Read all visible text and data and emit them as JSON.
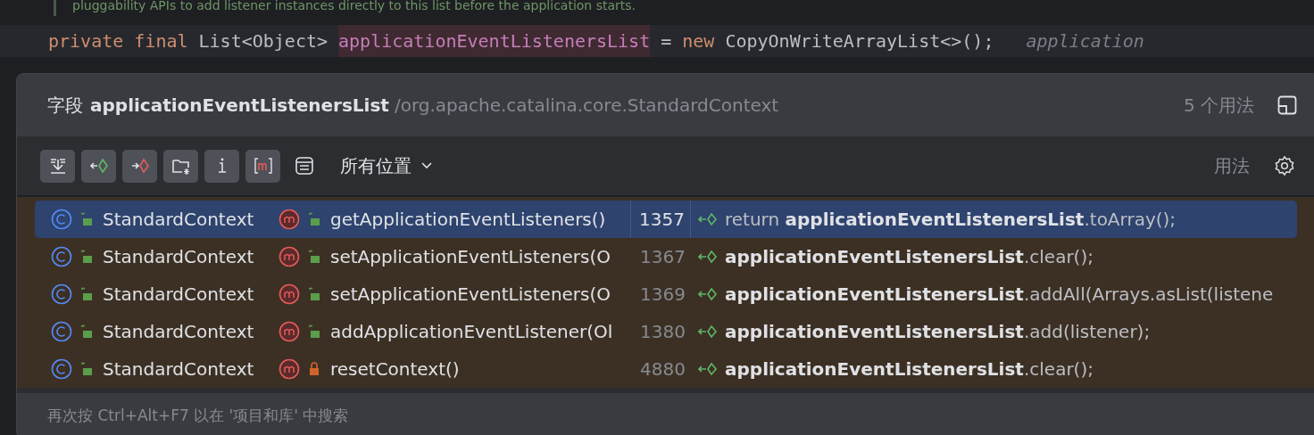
{
  "editor": {
    "comment": "pluggability APIs to add listener instances directly to this list before the application starts.",
    "code": [
      {
        "text": "private",
        "kind": "keyword"
      },
      {
        "text": "final",
        "kind": "keyword"
      },
      {
        "text": "List<Object>",
        "kind": "plain"
      },
      {
        "text": "applicationEventListenersList",
        "kind": "field"
      },
      {
        "text": "=",
        "kind": "plain"
      },
      {
        "text": "new",
        "kind": "keyword"
      },
      {
        "text": "CopyOnWriteArrayList<>();",
        "kind": "plain"
      },
      {
        "text": "application",
        "kind": "hint"
      }
    ]
  },
  "popup": {
    "kind_label": "字段",
    "name": "applicationEventListenersList",
    "path": "/org.apache.catalina.core.StandardContext",
    "count": "5 个用法",
    "toolbar": [
      {
        "pressed": true
      },
      {
        "pressed": true
      },
      {
        "pressed": true
      },
      {
        "pressed": true
      },
      {
        "pressed": true
      },
      {
        "pressed": true
      },
      {
        "pressed": false
      }
    ],
    "scope": "所有位置",
    "filter_label": "用法",
    "rows": [
      {
        "class_name": "StandardContext",
        "method": "getApplicationEventListeners()",
        "locked": false,
        "line": "1357",
        "code": "return **applicationEventListenersList**.toArray();",
        "selected": true
      },
      {
        "class_name": "StandardContext",
        "method": "setApplicationEventListeners(O",
        "locked": false,
        "line": "1367",
        "code": "**applicationEventListenersList**.clear();",
        "selected": false
      },
      {
        "class_name": "StandardContext",
        "method": "setApplicationEventListeners(O",
        "locked": false,
        "line": "1369",
        "code": "**applicationEventListenersList**.addAll(Arrays.asList(listene",
        "selected": false
      },
      {
        "class_name": "StandardContext",
        "method": "addApplicationEventListener(Ol",
        "locked": false,
        "line": "1380",
        "code": "**applicationEventListenersList**.add(listener);",
        "selected": false
      },
      {
        "class_name": "StandardContext",
        "method": "resetContext()",
        "locked": true,
        "line": "4880",
        "code": "**applicationEventListenersList**.clear();",
        "selected": false
      }
    ],
    "footer": "再次按 Ctrl+Alt+F7 以在 '项目和库' 中搜索"
  }
}
